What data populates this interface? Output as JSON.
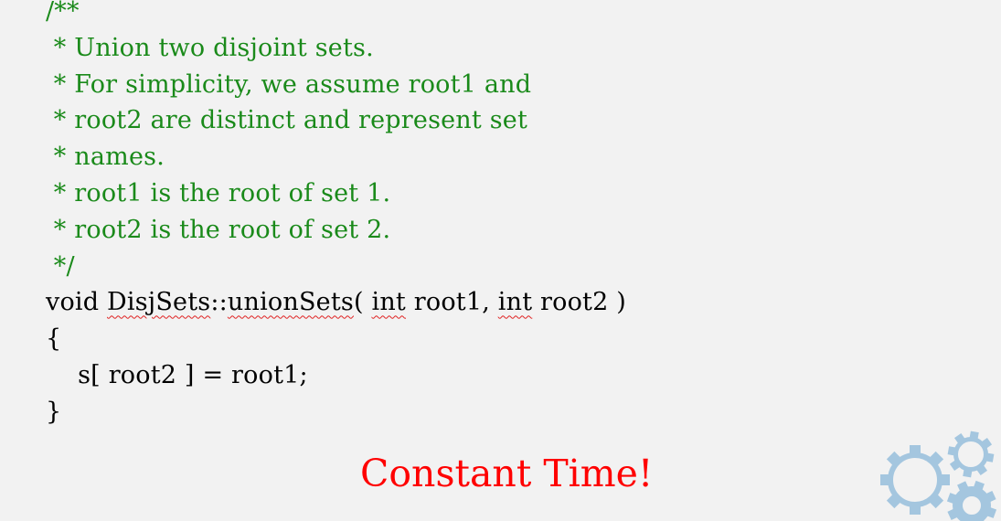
{
  "comment_lines": [
    "/**",
    " * Union two disjoint sets.",
    " * For simplicity, we assume root1 and",
    " * root2 are distinct and represent set",
    " * names.",
    " * root1 is the root of set 1.",
    " * root2 is the root of set 2.",
    " */"
  ],
  "signature": {
    "return_type": "void ",
    "class_name": "DisjSets",
    "separator": "::",
    "method_name": "unionSets",
    "open_paren": "( ",
    "param1_type": "int",
    "param1_name": " root1, ",
    "param2_type": "int",
    "param2_name": " root2 )"
  },
  "body_lines": [
    "{",
    "    s[ root2 ] = root1;",
    "}"
  ],
  "callout": "Constant Time!",
  "colors": {
    "comment": "#1a8a1a",
    "callout": "#ff0000",
    "gears": "#a4c6df",
    "background": "#f2f2f2"
  },
  "decoration_icon": "gears-icon"
}
